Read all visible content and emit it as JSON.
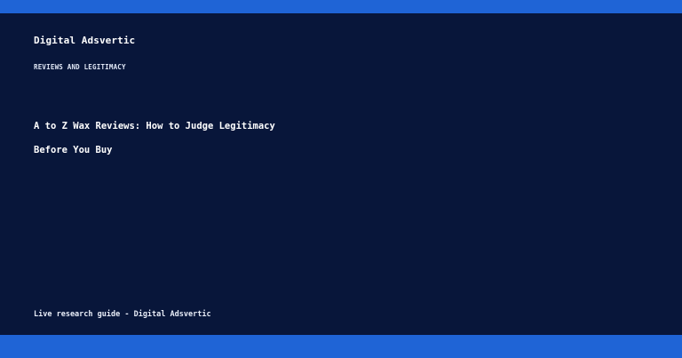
{
  "header": {
    "brand": "Digital Adsvertic",
    "kicker": "REVIEWS AND LEGITIMACY"
  },
  "article": {
    "title_lines": [
      "A to Z Wax Reviews: How to Judge Legitimacy",
      "Before You Buy"
    ]
  },
  "footer": {
    "note": "Live research guide - Digital Adsvertic"
  },
  "colors": {
    "background": "#08163a",
    "accent_bar": "#1f64d6",
    "text": "#ffffff"
  }
}
